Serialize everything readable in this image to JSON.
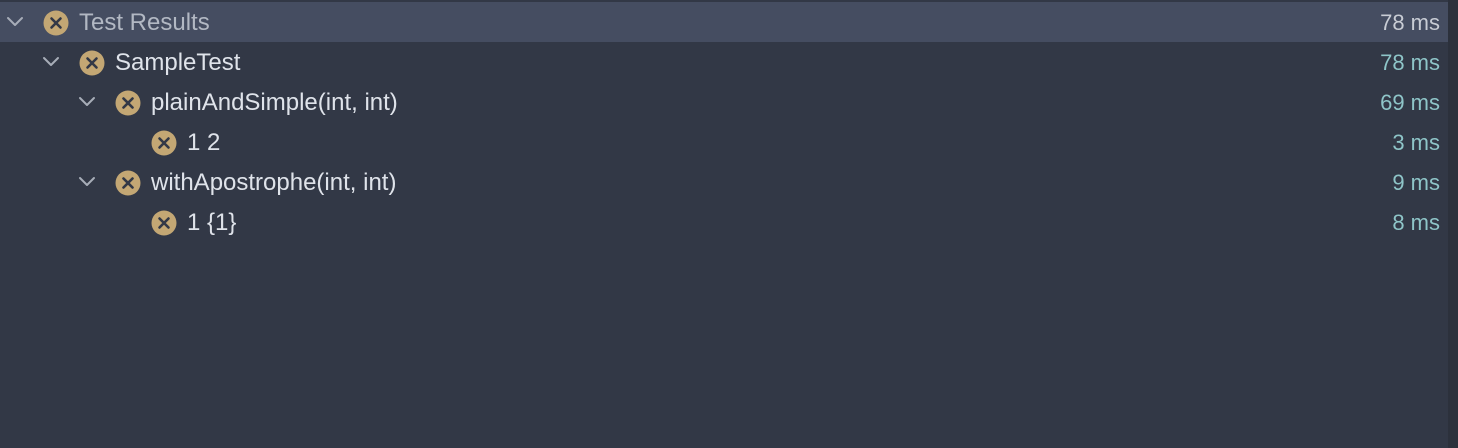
{
  "colors": {
    "background": "#323846",
    "selected_row": "#454d61",
    "label_text": "#dfe3ea",
    "root_label_text": "#b2b8c3",
    "duration_text": "#8ec5c8",
    "failed_icon": "#c3a774",
    "chevron": "#a7adb8"
  },
  "rows": [
    {
      "label": "Test Results",
      "duration": "78 ms",
      "status_icon": "failed-icon",
      "expanded": true
    },
    {
      "label": "SampleTest",
      "duration": "78 ms",
      "status_icon": "failed-icon",
      "expanded": true
    },
    {
      "label": "plainAndSimple(int, int)",
      "duration": "69 ms",
      "status_icon": "failed-icon",
      "expanded": true
    },
    {
      "label": "1 2",
      "duration": "3 ms",
      "status_icon": "failed-icon"
    },
    {
      "label": "withApostrophe(int, int)",
      "duration": "9 ms",
      "status_icon": "failed-icon",
      "expanded": true
    },
    {
      "label": "1 {1}",
      "duration": "8 ms",
      "status_icon": "failed-icon"
    }
  ]
}
